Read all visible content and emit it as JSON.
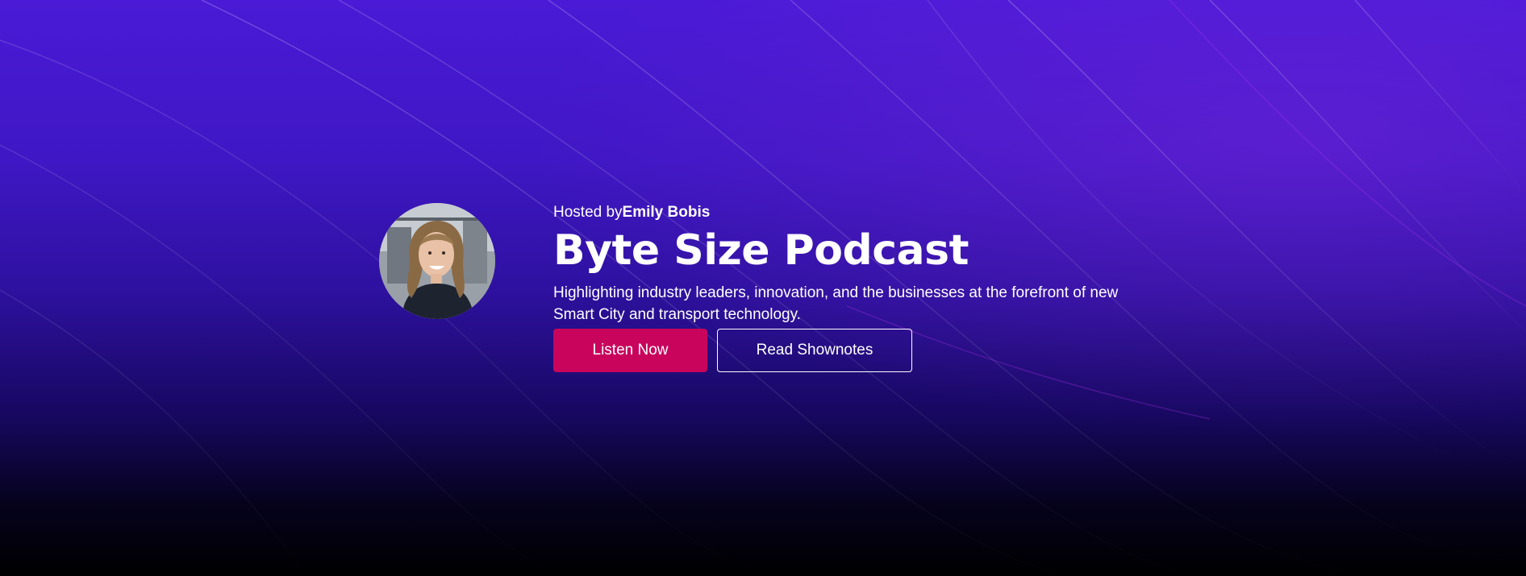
{
  "hero": {
    "hosted_prefix": "Hosted by",
    "host_name": "Emily Bobis",
    "title": "Byte Size Podcast",
    "description": "Highlighting industry leaders, innovation, and the businesses at the forefront of new Smart City and transport technology.",
    "listen_label": "Listen Now",
    "shownotes_label": "Read Shownotes"
  },
  "colors": {
    "background_top": "#4a1ad6",
    "background_bottom": "#000000",
    "primary_button": "#c8045c",
    "text": "#ffffff"
  }
}
